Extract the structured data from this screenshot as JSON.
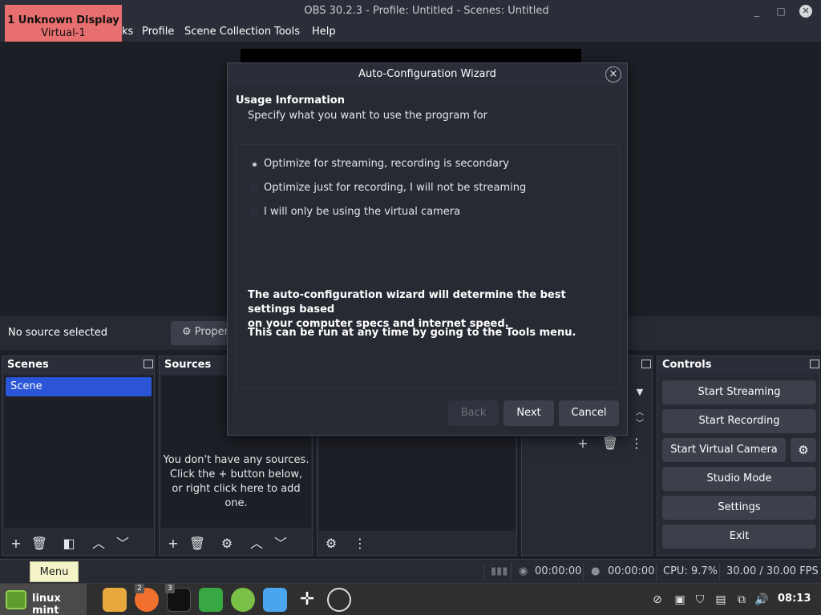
{
  "window": {
    "title": "OBS 30.2.3 - Profile: Untitled - Scenes: Untitled",
    "minimize": "_",
    "maximize": "□",
    "close": "✕"
  },
  "display_badge": {
    "line1": "1  Unknown Display",
    "line2": "Virtual-1"
  },
  "menubar": {
    "items": [
      "ks",
      "Profile",
      "Scene Collection",
      "Tools",
      "Help"
    ]
  },
  "source_toolbar": {
    "no_source": "No source selected",
    "properties_label": "Proper"
  },
  "docks": {
    "scenes": {
      "title": "Scenes",
      "items": [
        "Scene"
      ],
      "selected_index": 0
    },
    "sources": {
      "title": "Sources",
      "empty_line1": "You don't have any sources.",
      "empty_line2": "Click the + button below,",
      "empty_line3": "or right click here to add one."
    },
    "controls": {
      "title": "Controls",
      "buttons": [
        "Start Streaming",
        "Start Recording",
        "Start Virtual Camera",
        "Studio Mode",
        "Settings",
        "Exit"
      ]
    }
  },
  "statusbar": {
    "stream_time": "00:00:00",
    "record_time": "00:00:00",
    "cpu": "CPU: 9.7%",
    "fps": "30.00 / 30.00 FPS"
  },
  "tooltip": {
    "menu": "Menu"
  },
  "taskbar": {
    "menu_label": "linux mint",
    "badges": {
      "firefox": "2",
      "terminal": "3"
    },
    "clock": "08:13"
  },
  "dialog": {
    "title": "Auto-Configuration Wizard",
    "heading": "Usage Information",
    "subheading": "Specify what you want to use the program for",
    "options": [
      "Optimize for streaming, recording is secondary",
      "Optimize just for recording, I will not be streaming",
      "I will only be using the virtual camera"
    ],
    "selected_option": 0,
    "note1_line1": "The auto-configuration wizard will determine the best settings based",
    "note1_line2": "on your computer specs and internet speed.",
    "note2": "This can be run at any time by going to the Tools menu.",
    "buttons": {
      "back": "Back",
      "next": "Next",
      "cancel": "Cancel"
    }
  },
  "colors": {
    "accent_selected": "#2a55d6",
    "badge_red": "#e86f6f",
    "window_bg": "#1d1f26"
  }
}
